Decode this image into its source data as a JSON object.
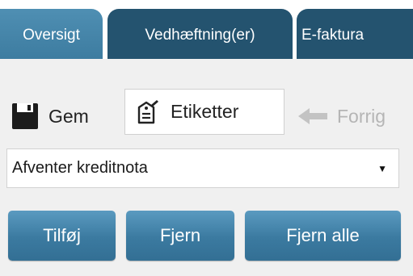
{
  "tabs": [
    {
      "label": "Oversigt",
      "active": true
    },
    {
      "label": "Vedhæftning(er)",
      "active": false
    },
    {
      "label": "E-faktura",
      "active": false
    }
  ],
  "toolbar": {
    "save_label": "Gem",
    "save_icon": "floppy-disk-icon",
    "tags_label": "Etiketter",
    "tags_icon": "tag-edit-icon",
    "prev_label": "Forrig",
    "prev_icon": "arrow-left-icon"
  },
  "status_select": {
    "value": "Afventer kreditnota",
    "caret": "▼"
  },
  "actions": {
    "add_label": "Tilføj",
    "remove_label": "Fjern",
    "remove_all_label": "Fjern alle"
  },
  "colors": {
    "active_tab": "#4a8ab0",
    "inactive_tab": "#24536f",
    "button": "#3d7ca0",
    "panel": "#f0f0f0"
  }
}
